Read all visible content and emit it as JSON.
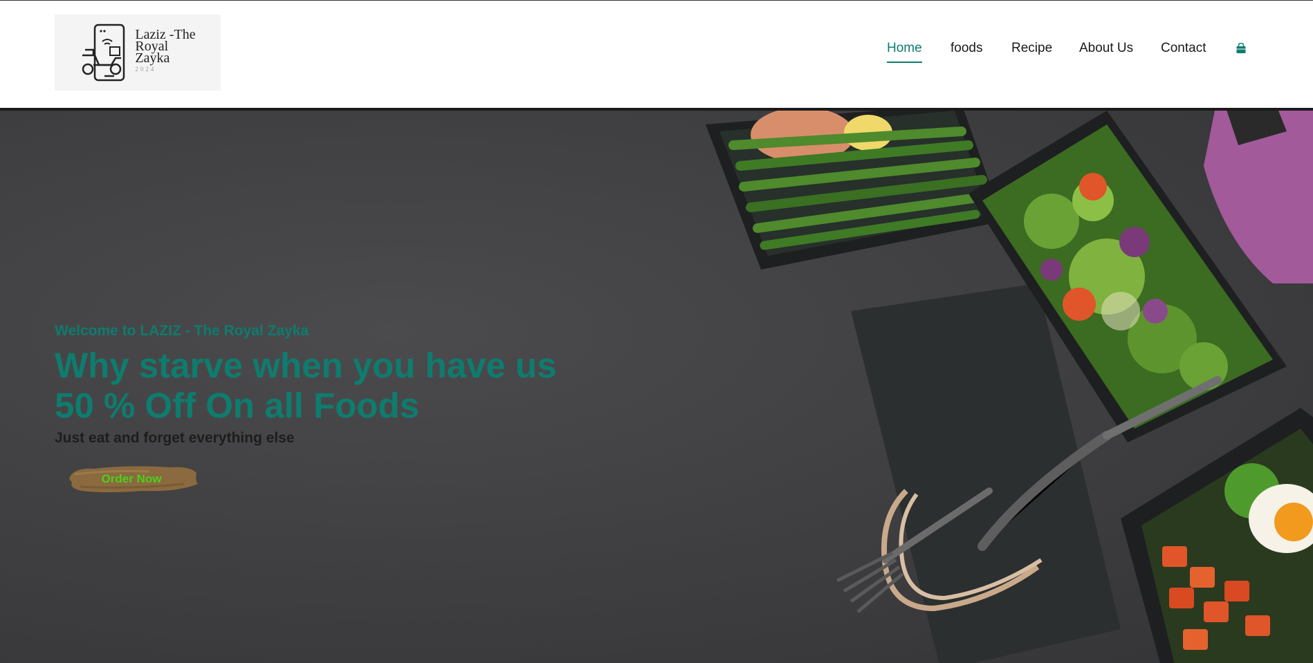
{
  "brand": {
    "name_line1": "Laziz -The",
    "name_line2": "Royal",
    "name_line3": "Zayka",
    "year": "2024",
    "icon": "delivery-scooter-phone-icon"
  },
  "nav": {
    "items": [
      {
        "label": "Home",
        "active": true
      },
      {
        "label": "foods",
        "active": false
      },
      {
        "label": "Recipe",
        "active": false
      },
      {
        "label": "About Us",
        "active": false
      },
      {
        "label": "Contact",
        "active": false
      }
    ],
    "cart_icon": "shopping-bag-icon"
  },
  "hero": {
    "welcome": "Welcome to LAZIZ - The Royal Zayka",
    "title_line1": "Why starve when you have us",
    "title_line2": "50 % Off On all Foods",
    "subtitle": "Just eat and forget everything else",
    "cta_label": "Order Now"
  },
  "colors": {
    "accent": "#0e7c6e",
    "cta_text": "#49d11b",
    "cta_brush": "#8a6a3e",
    "hero_bg": "#3d3d3f"
  }
}
